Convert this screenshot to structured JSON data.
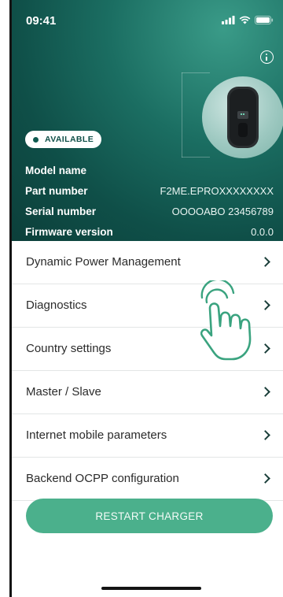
{
  "status_bar": {
    "time": "09:41",
    "icons": [
      "signal-icon",
      "wifi-icon",
      "battery-icon"
    ]
  },
  "hero": {
    "status_badge": "AVAILABLE",
    "specs": [
      {
        "label": "Model name",
        "value": ""
      },
      {
        "label": "Part number",
        "value": "F2ME.EPROXXXXXXXX"
      },
      {
        "label": "Serial number",
        "value": "OOOOABO 23456789"
      },
      {
        "label": "Firmware version",
        "value": "0.0.0"
      }
    ],
    "info_icon": "info-icon"
  },
  "menu": {
    "items": [
      {
        "label": "Dynamic Power Management"
      },
      {
        "label": "Diagnostics"
      },
      {
        "label": "Country settings"
      },
      {
        "label": "Master / Slave"
      },
      {
        "label": "Internet mobile parameters"
      },
      {
        "label": "Backend OCPP configuration"
      }
    ]
  },
  "actions": {
    "restart_label": "RESTART CHARGER"
  },
  "colors": {
    "hero_dark": "#0c3f3a",
    "hero_light": "#3a9b88",
    "accent_green": "#4bb08c",
    "hand_outline": "#3aa37f"
  }
}
